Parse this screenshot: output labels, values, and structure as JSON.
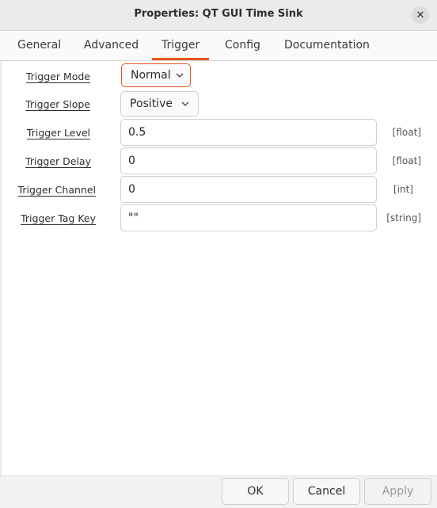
{
  "window": {
    "title": "Properties: QT GUI Time Sink",
    "close_icon": "✕"
  },
  "tabs": [
    {
      "label": "General",
      "active": false
    },
    {
      "label": "Advanced",
      "active": false
    },
    {
      "label": "Trigger",
      "active": true
    },
    {
      "label": "Config",
      "active": false
    },
    {
      "label": "Documentation",
      "active": false
    }
  ],
  "accent_color": "#e95420",
  "form": {
    "trigger_mode": {
      "label": "Trigger Mode",
      "value": "Normal",
      "icon": "chevron-down-icon"
    },
    "trigger_slope": {
      "label": "Trigger Slope",
      "value": "Positive",
      "icon": "chevron-down-icon"
    },
    "trigger_level": {
      "label": "Trigger Level",
      "value": "0.5",
      "type": "[float]"
    },
    "trigger_delay": {
      "label": "Trigger Delay",
      "value": "0",
      "type": "[float]"
    },
    "trigger_channel": {
      "label": "Trigger Channel",
      "value": "0",
      "type": "[int]"
    },
    "trigger_tag_key": {
      "label": "Trigger Tag Key",
      "value": "\"\"",
      "type": "[string]"
    }
  },
  "buttons": {
    "ok": "OK",
    "cancel": "Cancel",
    "apply": "Apply"
  }
}
